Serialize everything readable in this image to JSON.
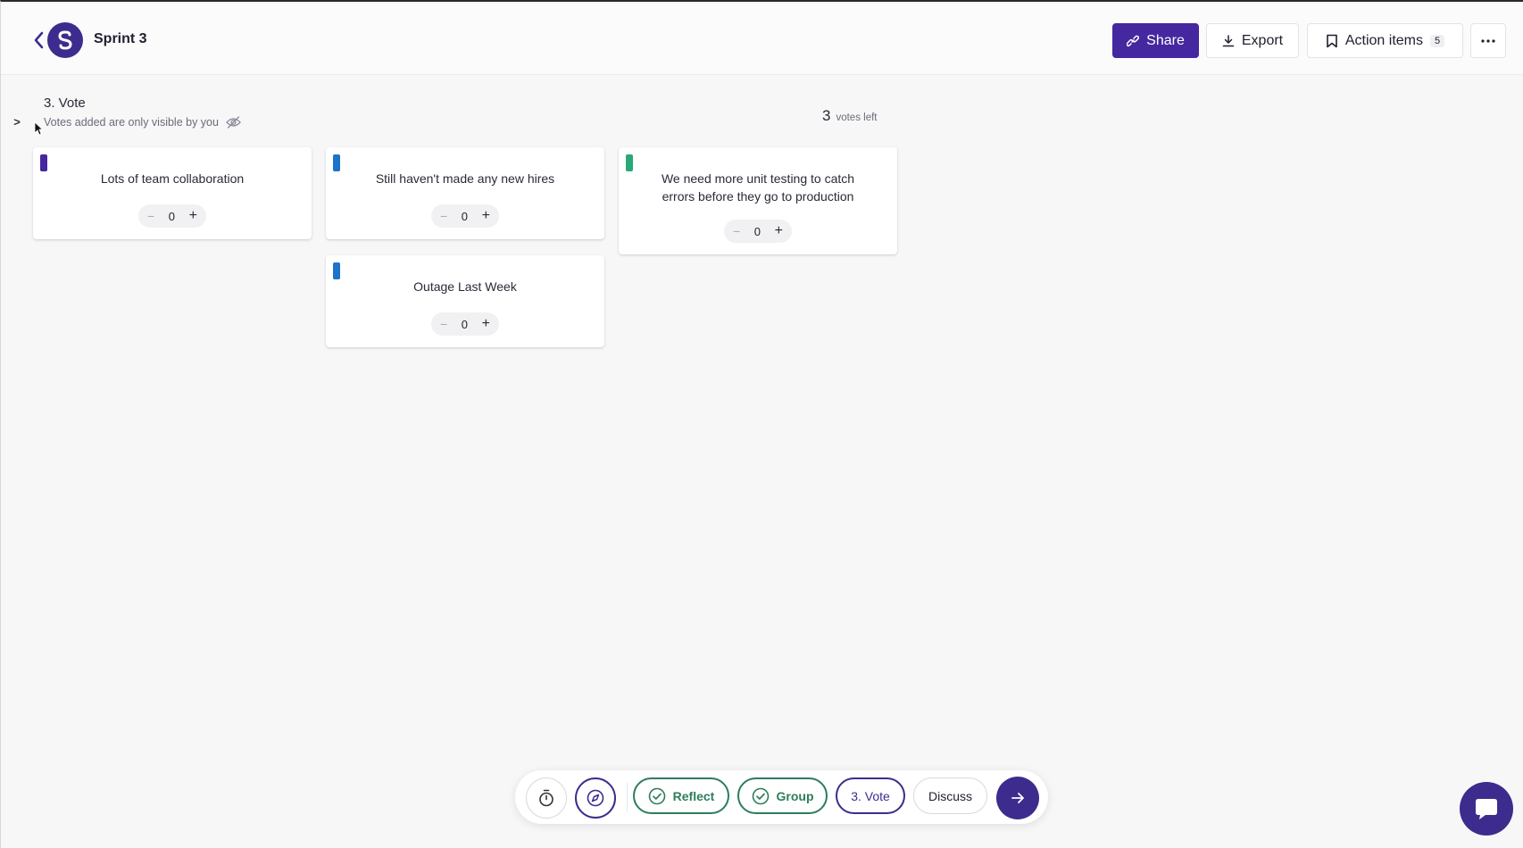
{
  "header": {
    "board_title": "Sprint 3",
    "share_label": "Share",
    "export_label": "Export",
    "action_items_label": "Action items",
    "action_items_count": "5"
  },
  "section": {
    "step_title": "3. Vote",
    "subtitle": "Votes added are only visible by you",
    "votes_left_count": "3",
    "votes_left_label": "votes left",
    "sidebar_toggle": ">"
  },
  "cards": [
    {
      "text": "Lots of team collaboration",
      "votes": "0",
      "color": "#4527a0"
    },
    {
      "text": "Still haven't made any new hires",
      "votes": "0",
      "color": "#1e73c8"
    },
    {
      "text": "We need more unit testing to catch errors before they go to production",
      "votes": "0",
      "color": "#2aa876"
    },
    {
      "text": "Outage Last Week",
      "votes": "0",
      "color": "#1e73c8"
    }
  ],
  "toolbar": {
    "reflect_label": "Reflect",
    "group_label": "Group",
    "vote_label": "3. Vote",
    "discuss_label": "Discuss"
  },
  "colors": {
    "brand": "#3d2c8d",
    "done_green": "#2e7d5b"
  }
}
